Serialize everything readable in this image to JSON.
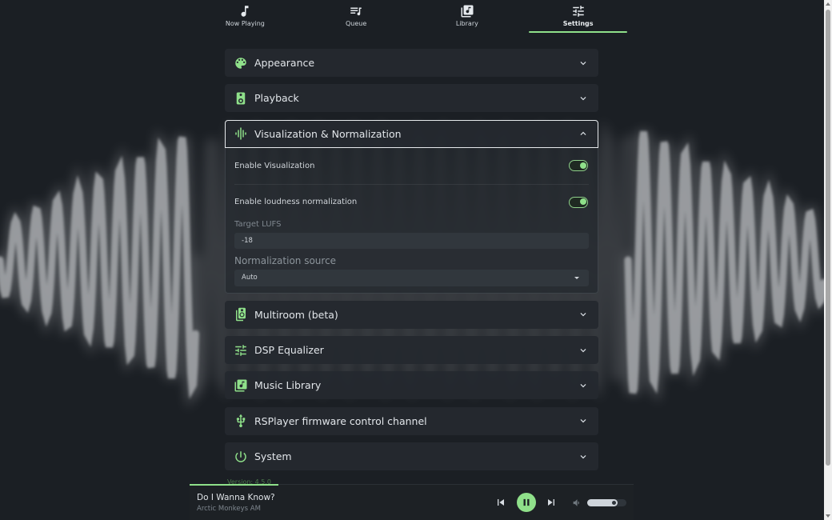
{
  "colors": {
    "accent": "#8fe08a",
    "background": "#1b1f24",
    "panel": "#24292f",
    "wave": "#a6a8ab"
  },
  "nav": {
    "tabs": [
      {
        "label": "Now Playing",
        "icon": "music-note-icon"
      },
      {
        "label": "Queue",
        "icon": "queue-icon"
      },
      {
        "label": "Library",
        "icon": "library-icon"
      },
      {
        "label": "Settings",
        "icon": "tune-icon",
        "active": true
      }
    ]
  },
  "settings": {
    "panels": [
      {
        "title": "Appearance",
        "icon": "palette-icon"
      },
      {
        "title": "Playback",
        "icon": "speaker-icon"
      },
      {
        "title": "Visualization & Normalization",
        "icon": "waveform-icon",
        "expanded": true
      },
      {
        "title": "Multiroom (beta)",
        "icon": "speaker-group-icon"
      },
      {
        "title": "DSP Equalizer",
        "icon": "equalizer-icon"
      },
      {
        "title": "Music Library",
        "icon": "library-music-icon"
      },
      {
        "title": "RSPlayer firmware control channel",
        "icon": "usb-icon"
      },
      {
        "title": "System",
        "icon": "power-icon"
      }
    ],
    "visualization": {
      "enable_visualization_label": "Enable Visualization",
      "enable_visualization": true,
      "enable_normalization_label": "Enable loudness normalization",
      "enable_normalization": true,
      "target_lufs_label": "Target LUFS",
      "target_lufs_value": "-18",
      "normalization_source_label": "Normalization source",
      "normalization_source_value": "Auto"
    }
  },
  "version": "Version: 4.5.0",
  "player": {
    "title": "Do I Wanna Know?",
    "artist": "Arctic Monkeys AM",
    "state": "playing",
    "progress": 0.2,
    "volume": 0.78
  }
}
